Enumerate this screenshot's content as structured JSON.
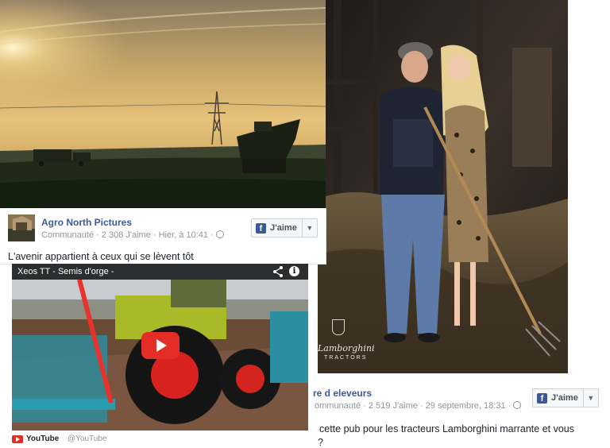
{
  "post_left": {
    "page_name": "Agro North Pictures",
    "meta": "Communauté · 2 308 J'aime · Hier, à 10:41 · ",
    "globe_icon": "globe-icon",
    "caption": "L'avenir appartient à ceux qui se lèvent tôt",
    "like_button": {
      "label": "J'aime",
      "icon": "facebook-f-icon"
    }
  },
  "video": {
    "title": "Xeos TT - Semis d'orge -",
    "share_icon": "share-icon",
    "info_icon": "i",
    "source_name": "YouTube",
    "source_handle": "@YouTube"
  },
  "post_right": {
    "page_name": "re d eleveurs",
    "meta": "ommunauté · 2 519 J'aime · 29 septembre, 18:31 · ",
    "globe_icon": "globe-icon",
    "caption": "cette pub pour les tracteurs Lamborghini marrante et vous",
    "caption_line2": "?",
    "like_button": {
      "label": "J'aime",
      "icon": "facebook-f-icon"
    },
    "ad_brand": "Lamborghini",
    "ad_sub": "TRACTORS"
  },
  "colors": {
    "link": "#3b5998",
    "meta": "#90949c",
    "youtube_red": "#e52d27"
  }
}
